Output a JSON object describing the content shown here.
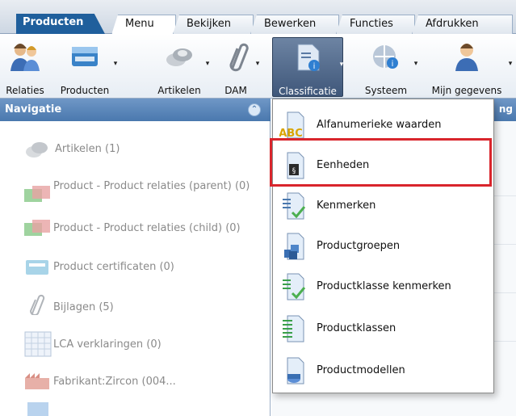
{
  "app_tab": "Producten",
  "tabs": [
    "Menu",
    "Bekijken",
    "Bewerken",
    "Functies",
    "Afdrukken"
  ],
  "ribbon": {
    "buttons": [
      {
        "label": "Relaties",
        "icon": "people-icon"
      },
      {
        "label": "Producten",
        "icon": "product-box-icon"
      },
      {
        "label": "Artikelen",
        "icon": "articles-icon"
      },
      {
        "label": "DAM",
        "icon": "paperclip-icon"
      },
      {
        "label": "Classificatie",
        "icon": "classification-icon"
      },
      {
        "label": "Systeem",
        "icon": "system-globe-icon"
      },
      {
        "label": "Mijn gegevens",
        "icon": "user-icon"
      }
    ]
  },
  "navigation": {
    "title": "Navigatie",
    "items": [
      {
        "label": "Artikelen (1)",
        "icon": "articles-icon"
      },
      {
        "label": "Product - Product relaties (parent) (0)",
        "icon": "product-relations-icon"
      },
      {
        "label": "Product - Product relaties (child) (0)",
        "icon": "product-relations-icon"
      },
      {
        "label": "Product certificaten (0)",
        "icon": "certificate-icon"
      },
      {
        "label": "Bijlagen (5)",
        "icon": "paperclip-icon"
      },
      {
        "label": "LCA verklaringen (0)",
        "icon": "grid-table-icon"
      },
      {
        "label": "Fabrikant:Zircon (004...",
        "icon": "factory-icon"
      }
    ]
  },
  "content_header_fragment": "ng",
  "menu": {
    "items": [
      {
        "label": "Alfanumerieke waarden",
        "icon": "abc-document-icon"
      },
      {
        "label": "Eenheden",
        "icon": "units-document-icon"
      },
      {
        "label": "Kenmerken",
        "icon": "features-check-icon"
      },
      {
        "label": "Productgroepen",
        "icon": "product-groups-icon"
      },
      {
        "label": "Productklasse kenmerken",
        "icon": "class-features-check-icon"
      },
      {
        "label": "Productklassen",
        "icon": "product-classes-icon"
      },
      {
        "label": "Productmodellen",
        "icon": "product-models-icon"
      }
    ],
    "highlighted": "Eenheden"
  },
  "colors": {
    "accent": "#1f5f9c",
    "highlight_border": "#d9252c",
    "nav_header": "#4a78ae"
  }
}
